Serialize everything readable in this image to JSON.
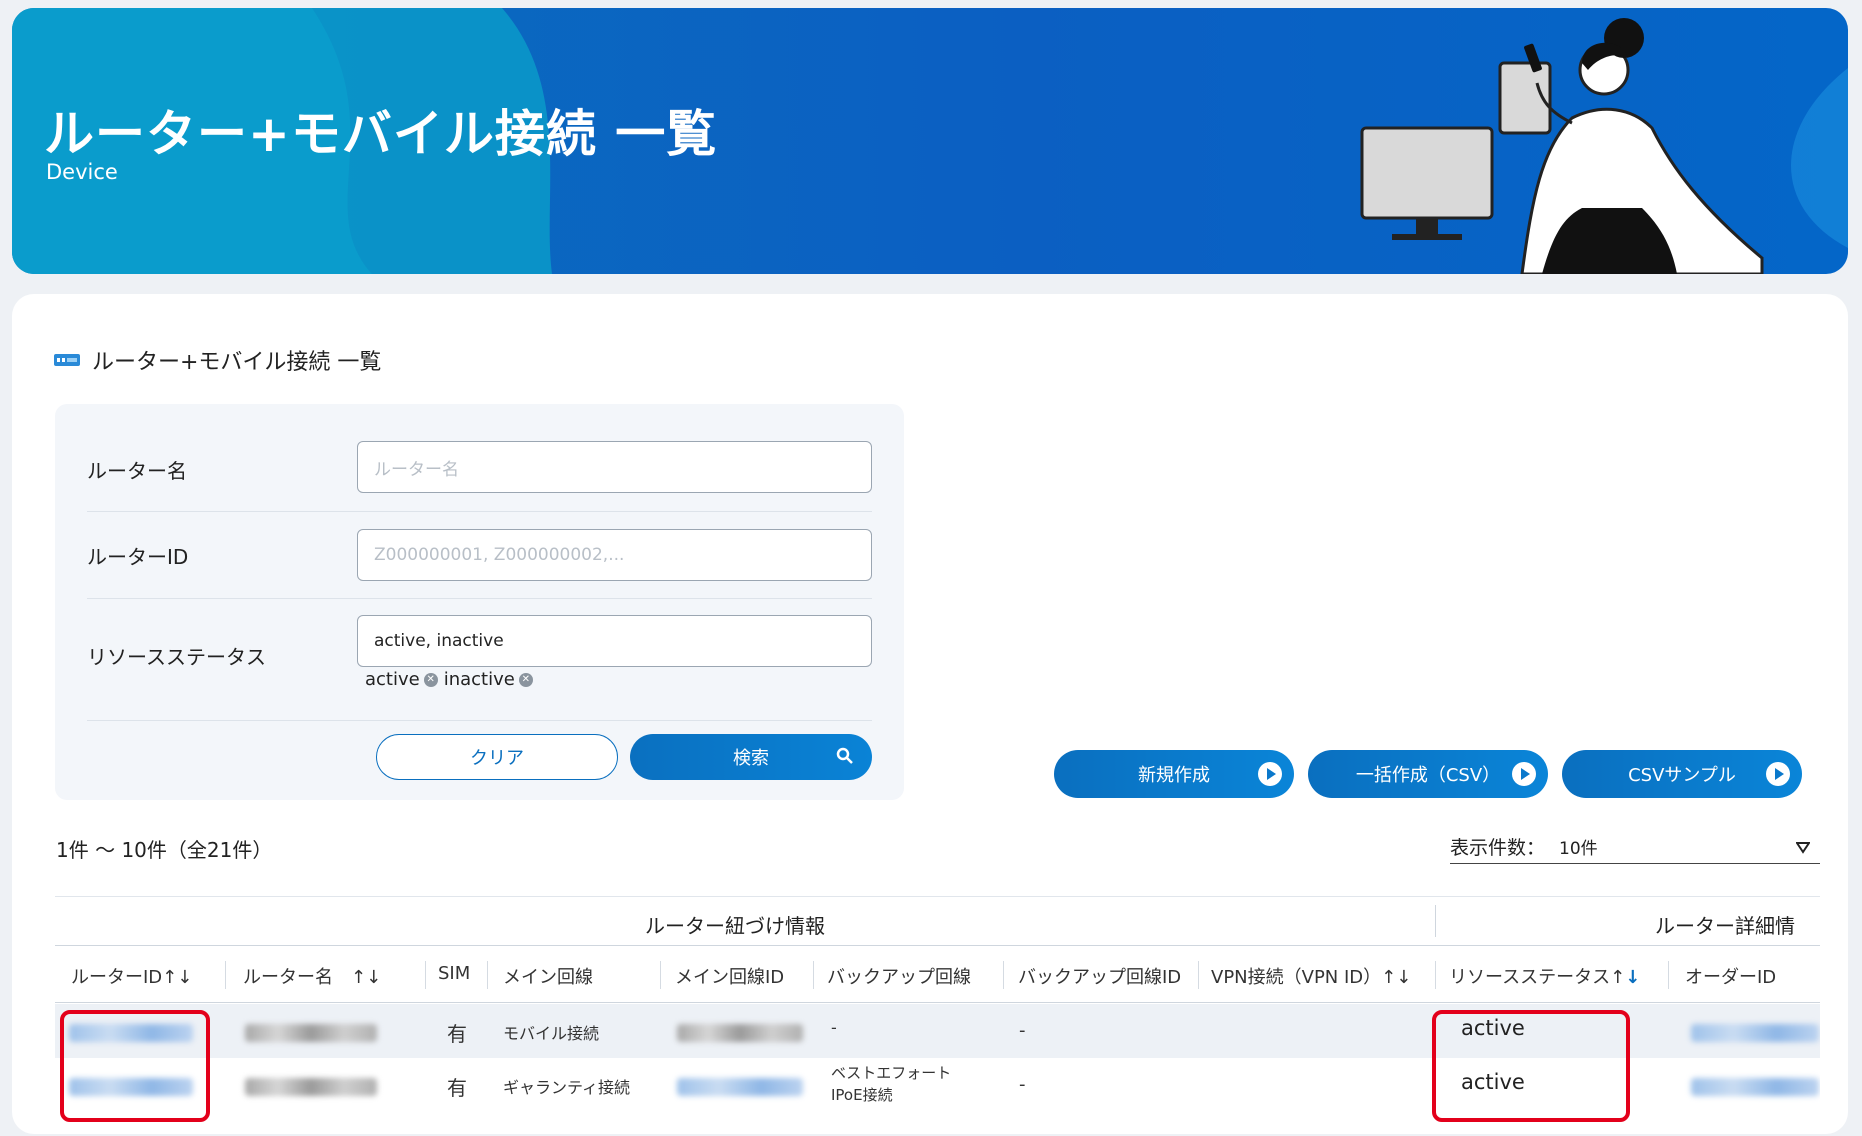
{
  "banner": {
    "title": "ルーター+モバイル接続 一覧",
    "subtitle": "Device"
  },
  "section": {
    "title": "ルーター+モバイル接続 一覧"
  },
  "filter": {
    "router_name": {
      "label": "ルーター名",
      "placeholder": "ルーター名",
      "value": ""
    },
    "router_id": {
      "label": "ルーターID",
      "placeholder": "Z000000001, Z000000002,..."
    },
    "resource_status": {
      "label": "リソースステータス",
      "value": "active, inactive",
      "chips": [
        "active",
        "inactive"
      ]
    },
    "clear_label": "クリア",
    "search_label": "検索"
  },
  "actions": {
    "new_label": "新規作成",
    "bulk_label": "一括作成（CSV）",
    "sample_label": "CSVサンプル"
  },
  "list": {
    "count_text": "1件 ～ 10件（全21件）",
    "per_page_label": "表示件数：",
    "per_page_value": "10件"
  },
  "table": {
    "groups": [
      "ルーター紐づけ情報",
      "ルーター詳細情"
    ],
    "headers": [
      "ルーターID↑↓",
      "ルーター名　↑↓",
      "SIM",
      "メイン回線",
      "メイン回線ID",
      "バックアップ回線",
      "バックアップ回線ID",
      "VPN接続（VPN ID）↑↓",
      "リソースステータス↑",
      "オーダーID"
    ],
    "sort_active_arrow": "↓",
    "rows": [
      {
        "sim": "有",
        "main_line": "モバイル接続",
        "backup_line": "-",
        "backup_line2": "",
        "backup_id": "-",
        "status": "active"
      },
      {
        "sim": "有",
        "main_line": "ギャランティ接続",
        "backup_line": "ベストエフォート",
        "backup_line2": "IPoE接続",
        "backup_id": "-",
        "status": "active"
      }
    ]
  },
  "colors": {
    "accent": "#0a6fbf",
    "highlight": "#e3001b"
  }
}
